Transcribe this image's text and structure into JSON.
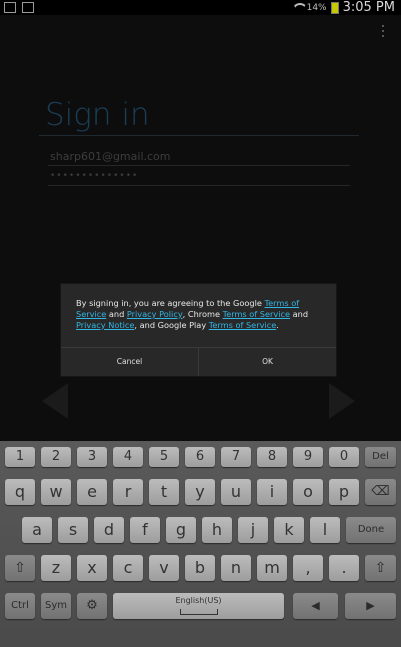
{
  "status_bar": {
    "battery_percent": "14%",
    "time": "3:05 PM"
  },
  "signin": {
    "title": "Sign in",
    "email": "sharp601@gmail.com",
    "password_mask": "••••••••••••••"
  },
  "dialog": {
    "text_1": "By signing in, you are agreeing to the Google ",
    "link_tos_google": "Terms of Service",
    "text_2": " and ",
    "link_privacy_policy": "Privacy Policy",
    "text_3": ", Chrome ",
    "link_tos_chrome": "Terms of Service",
    "text_4": " and ",
    "link_privacy_notice": "Privacy Notice",
    "text_5": ", and Google Play ",
    "link_tos_play": "Terms of Service",
    "text_6": ".",
    "cancel_label": "Cancel",
    "ok_label": "OK"
  },
  "keyboard": {
    "row1": [
      {
        "label": "1",
        "sup": ""
      },
      {
        "label": "2",
        "sup": ""
      },
      {
        "label": "3",
        "sup": ""
      },
      {
        "label": "4",
        "sup": ""
      },
      {
        "label": "5",
        "sup": ""
      },
      {
        "label": "6",
        "sup": ""
      },
      {
        "label": "7",
        "sup": ""
      },
      {
        "label": "8",
        "sup": ""
      },
      {
        "label": "9",
        "sup": ""
      },
      {
        "label": "0",
        "sup": ""
      }
    ],
    "del_label": "Del",
    "row2": [
      "q",
      "w",
      "e",
      "r",
      "t",
      "y",
      "u",
      "i",
      "o",
      "p"
    ],
    "row3": [
      "a",
      "s",
      "d",
      "f",
      "g",
      "h",
      "j",
      "k",
      "l"
    ],
    "done_label": "Done",
    "row4": [
      "z",
      "x",
      "c",
      "v",
      "b",
      "n",
      "m"
    ],
    "ctrl_label": "Ctrl",
    "sym_label": "Sym",
    "language_label": "English(US)"
  }
}
